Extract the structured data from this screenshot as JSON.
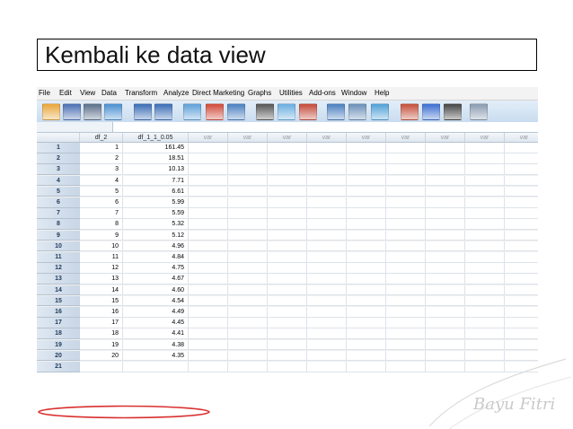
{
  "slide": {
    "title": "Kembali ke data view"
  },
  "watermark": {
    "text": "Bayu Fitri"
  },
  "menu": [
    {
      "label": "File"
    },
    {
      "label": "Edit"
    },
    {
      "label": "View"
    },
    {
      "label": "Data"
    },
    {
      "label": "Transform"
    },
    {
      "label": "Analyze"
    },
    {
      "label": "Direct Marketing"
    },
    {
      "label": "Graphs"
    },
    {
      "label": "Utilities"
    },
    {
      "label": "Add-ons"
    },
    {
      "label": "Window"
    },
    {
      "label": "Help"
    }
  ],
  "toolbar": [
    {
      "icon": "open-folder-icon",
      "color": "#e8a63a"
    },
    {
      "icon": "save-icon",
      "color": "#4a6fb3"
    },
    {
      "icon": "print-icon",
      "color": "#5a6f8a"
    },
    {
      "icon": "dialog-recall-icon",
      "color": "#4a8fd0"
    },
    {
      "icon": "undo-icon",
      "color": "#3a6db5"
    },
    {
      "icon": "redo-icon",
      "color": "#3a6db5"
    },
    {
      "icon": "goto-case-icon",
      "color": "#5fa0d8"
    },
    {
      "icon": "goto-variable-icon",
      "color": "#d04a3a"
    },
    {
      "icon": "variables-icon",
      "color": "#4a7fc0"
    },
    {
      "icon": "find-icon",
      "color": "#555555"
    },
    {
      "icon": "insert-cases-icon",
      "color": "#6aaee0"
    },
    {
      "icon": "insert-variable-icon",
      "color": "#c44a3a"
    },
    {
      "icon": "split-file-icon",
      "color": "#4a7fc0"
    },
    {
      "icon": "weight-cases-icon",
      "color": "#6b8fb8"
    },
    {
      "icon": "select-cases-icon",
      "color": "#4fa0d8"
    },
    {
      "icon": "value-labels-icon",
      "color": "#c4503a"
    },
    {
      "icon": "use-sets-icon",
      "color": "#3a6fd0"
    },
    {
      "icon": "show-all-variables-icon",
      "color": "#444444"
    },
    {
      "icon": "spell-check-icon",
      "color": "#8a9ab0"
    }
  ],
  "columns": [
    {
      "name": "df_2",
      "kind": "data"
    },
    {
      "name": "df_1_1_0.05",
      "kind": "data"
    },
    {
      "name": "var",
      "kind": "var"
    },
    {
      "name": "var",
      "kind": "var"
    },
    {
      "name": "var",
      "kind": "var"
    },
    {
      "name": "var",
      "kind": "var"
    },
    {
      "name": "var",
      "kind": "var"
    },
    {
      "name": "var",
      "kind": "var"
    },
    {
      "name": "var",
      "kind": "var"
    },
    {
      "name": "var",
      "kind": "var"
    },
    {
      "name": "var",
      "kind": "var"
    }
  ],
  "rows": [
    {
      "n": "1",
      "df_2": "1",
      "df_1": "161.45"
    },
    {
      "n": "2",
      "df_2": "2",
      "df_1": "18.51"
    },
    {
      "n": "3",
      "df_2": "3",
      "df_1": "10.13"
    },
    {
      "n": "4",
      "df_2": "4",
      "df_1": "7.71"
    },
    {
      "n": "5",
      "df_2": "5",
      "df_1": "6.61"
    },
    {
      "n": "6",
      "df_2": "6",
      "df_1": "5.99"
    },
    {
      "n": "7",
      "df_2": "7",
      "df_1": "5.59"
    },
    {
      "n": "8",
      "df_2": "8",
      "df_1": "5.32"
    },
    {
      "n": "9",
      "df_2": "9",
      "df_1": "5.12"
    },
    {
      "n": "10",
      "df_2": "10",
      "df_1": "4.96"
    },
    {
      "n": "11",
      "df_2": "11",
      "df_1": "4.84"
    },
    {
      "n": "12",
      "df_2": "12",
      "df_1": "4.75"
    },
    {
      "n": "13",
      "df_2": "13",
      "df_1": "4.67"
    },
    {
      "n": "14",
      "df_2": "14",
      "df_1": "4.60"
    },
    {
      "n": "15",
      "df_2": "15",
      "df_1": "4.54"
    },
    {
      "n": "16",
      "df_2": "16",
      "df_1": "4.49"
    },
    {
      "n": "17",
      "df_2": "17",
      "df_1": "4.45"
    },
    {
      "n": "18",
      "df_2": "18",
      "df_1": "4.41"
    },
    {
      "n": "19",
      "df_2": "19",
      "df_1": "4.38"
    },
    {
      "n": "20",
      "df_2": "20",
      "df_1": "4.35"
    },
    {
      "n": "21",
      "df_2": "",
      "df_1": ""
    }
  ],
  "highlight": {
    "row": "17",
    "color": "#d93030"
  }
}
